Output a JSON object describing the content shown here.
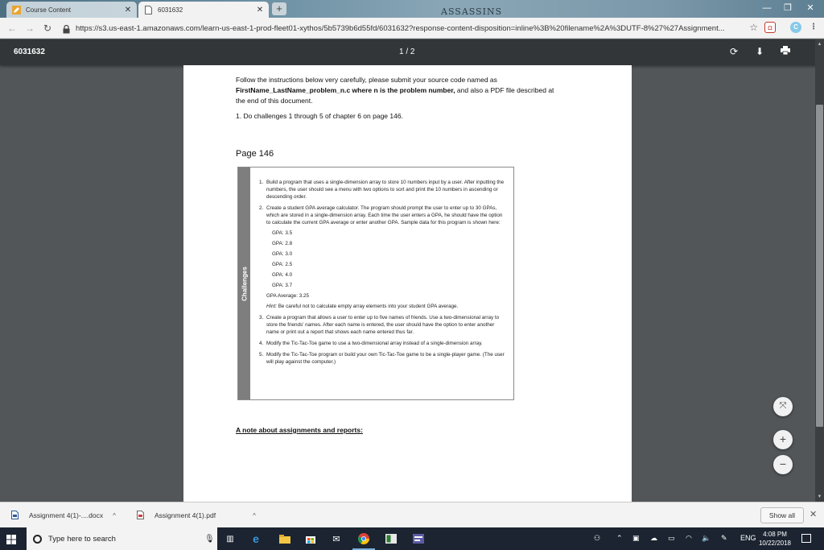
{
  "browser": {
    "tabs": [
      {
        "title": "Course Content",
        "active": false
      },
      {
        "title": "6031632",
        "active": true
      }
    ],
    "banner_text": "ASSASSINS",
    "url": "https://s3.us-east-1.amazonaws.com/learn-us-east-1-prod-fleet01-xythos/5b5739b6d55fd/6031632?response-content-disposition=inline%3B%20filename%2A%3DUTF-8%27%27Assignment...",
    "extension_badge": "C"
  },
  "pdf_viewer": {
    "title": "6031632",
    "page_indicator": "1 / 2"
  },
  "document": {
    "intro_line1": "Follow the instructions below very carefully, please submit your source code named as",
    "intro_bold": "FirstName_LastName_problem_n.c where n is the problem number,",
    "intro_rest": " and also a PDF file described at",
    "intro_line3": "the end of this document.",
    "item1": "1. Do challenges 1 through 5 of chapter 6 on page 146.",
    "page_heading": "Page 146",
    "sidebar_label": "Challenges",
    "challenges": [
      {
        "num": "1.",
        "text": "Build a program that uses a single-dimension array to store 10 numbers input by a user. After inputting the numbers, the user should see a menu with two options to sort and print the 10 numbers in ascending or descending order."
      },
      {
        "num": "2.",
        "text": "Create a student GPA average calculator. The program should prompt the user to enter up to 30 GPAs, which are stored in a single-dimension array. Each time the user enters a GPA, he should have the option to calculate the current GPA average or enter another GPA. Sample data for this program is shown here:"
      }
    ],
    "gpa_lines": [
      "GPA: 3.5",
      "GPA: 2.8",
      "GPA: 3.0",
      "GPA: 2.5",
      "GPA: 4.0",
      "GPA: 3.7",
      "GPA Average: 3.25"
    ],
    "hint_label": "Hint:",
    "hint_text": " Be careful not to calculate empty array elements into your student GPA average.",
    "challenges_after": [
      {
        "num": "3.",
        "text": "Create a program that allows a user to enter up to five names of friends. Use a two-dimensional array to store the friends' names. After each name is entered, the user should have the option to enter another name or print out a report that shows each name entered thus far."
      },
      {
        "num": "4.",
        "text": "Modify the Tic-Tac-Toe game to use a two-dimensional array instead of a single-dimension array."
      },
      {
        "num": "5.",
        "text": "Modify the Tic-Tac-Toe program or build your own Tic-Tac-Toe game to be a single-player game. (The user will play against the computer.)"
      }
    ],
    "note_heading": "A note about assignments and reports:"
  },
  "downloads": {
    "items": [
      {
        "name": "Assignment 4(1)-....docx"
      },
      {
        "name": "Assignment 4(1).pdf"
      }
    ],
    "show_all": "Show all"
  },
  "taskbar": {
    "search_placeholder": "Type here to search",
    "language": "ENG",
    "time": "4:08 PM",
    "date": "10/22/2018"
  },
  "colors": {
    "pdf_toolbar": "#323639",
    "viewer_background": "#525659",
    "taskbar": "#1b2430",
    "challenge_sidebar": "#7e7e7e"
  }
}
